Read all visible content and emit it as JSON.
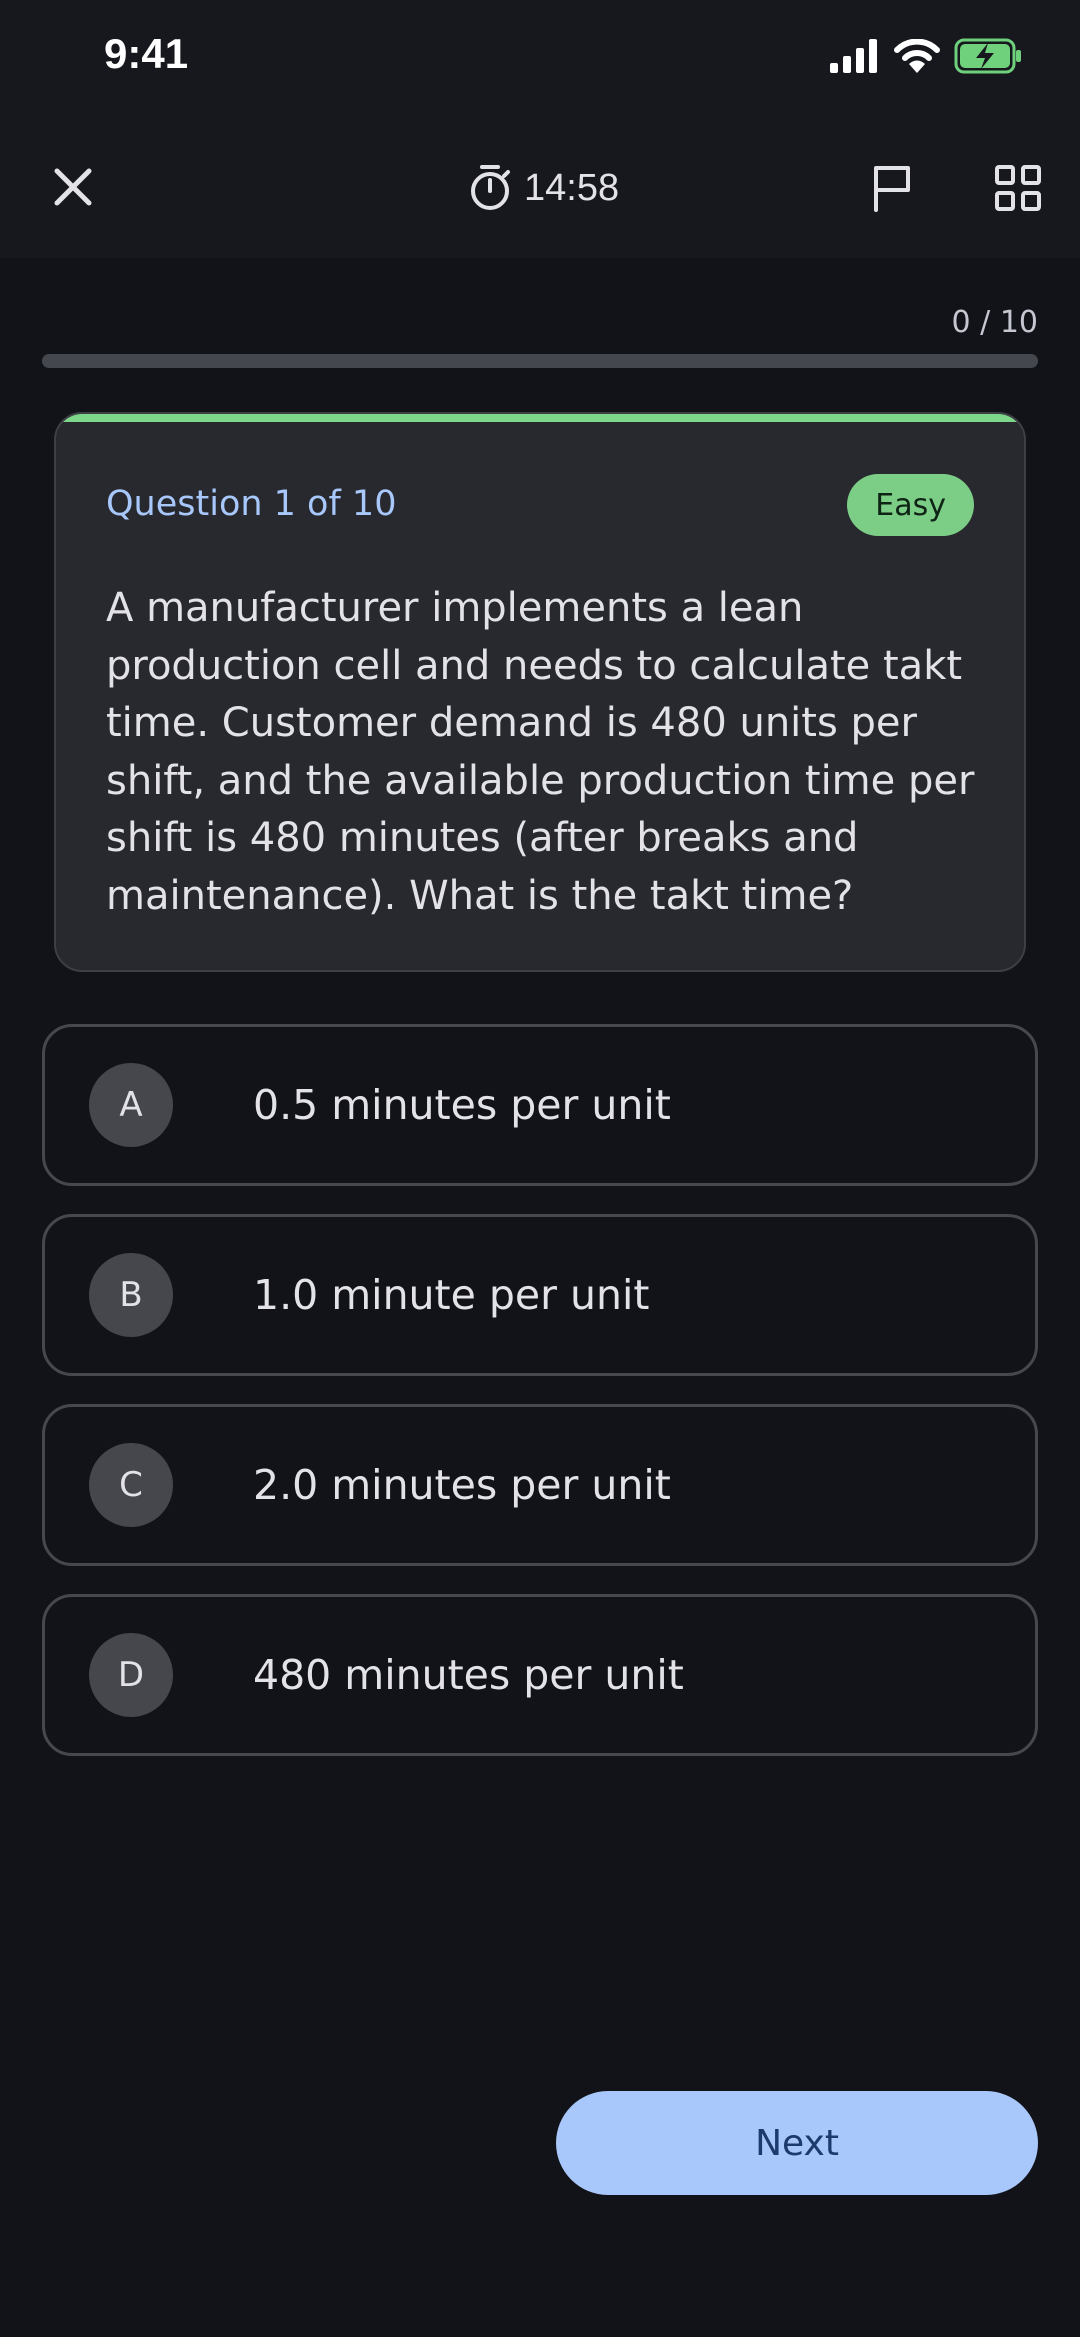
{
  "status_bar": {
    "time": "9:41",
    "icons": [
      "cellular-signal-icon",
      "wifi-icon",
      "battery-charging-icon"
    ]
  },
  "app_bar": {
    "close_icon": "close-icon",
    "timer_icon": "stopwatch-icon",
    "timer_value": "14:58",
    "flag_icon": "flag-icon",
    "grid_icon": "grid-view-icon"
  },
  "progress": {
    "count_text": "0 / 10",
    "fraction": 0
  },
  "question": {
    "label": "Question 1 of 10",
    "difficulty": "Easy",
    "text": "A manufacturer implements a lean production cell and needs to calculate takt time. Customer demand is 480 units per shift, and the available production time per shift is 480 minutes (after breaks and maintenance). What is the takt time?"
  },
  "options": [
    {
      "letter": "A",
      "text": "0.5 minutes per unit"
    },
    {
      "letter": "B",
      "text": "1.0 minute per unit"
    },
    {
      "letter": "C",
      "text": "2.0 minutes per unit"
    },
    {
      "letter": "D",
      "text": "480 minutes per unit"
    }
  ],
  "footer": {
    "next_label": "Next"
  },
  "colors": {
    "background": "#111318",
    "accent": "#a8c7fa",
    "card_top_accent": "#7dd68a",
    "badge": "#7ccd86",
    "battery": "#6fd17c"
  }
}
